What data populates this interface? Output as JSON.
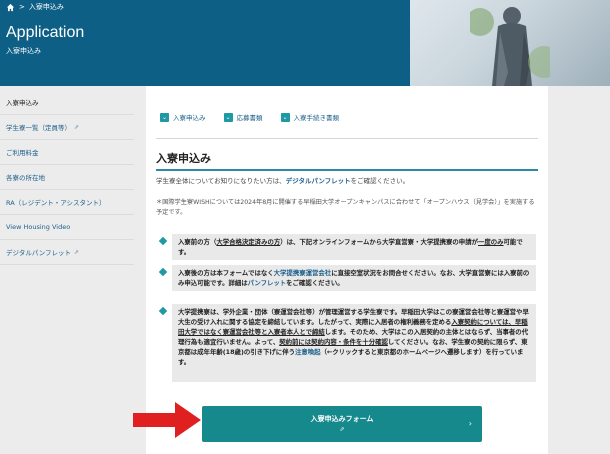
{
  "header": {
    "breadcrumb": {
      "home_icon": "home-icon",
      "separator": ">",
      "current": "入寮申込み"
    },
    "title": "Application",
    "subtitle": "入寮申込み",
    "colors": {
      "header_bg": "#0e5f86"
    }
  },
  "sidebar": {
    "items": [
      {
        "label": "入寮申込み",
        "external": false
      },
      {
        "label": "学生寮一覧（定員等）",
        "external": true
      },
      {
        "label": "ご利用料金",
        "external": false
      },
      {
        "label": "各寮の所在地",
        "external": false
      },
      {
        "label": "RA（レジデント・アシスタント）",
        "external": false
      },
      {
        "label": "View Housing Video",
        "external": false
      },
      {
        "label": "デジタルパンフレット",
        "external": true
      }
    ],
    "external_icon": "⇗"
  },
  "main": {
    "tabs": [
      {
        "label": "入寮申込み"
      },
      {
        "label": "応募書類"
      },
      {
        "label": "入寮手続き書類"
      }
    ],
    "section_title": "入寮申込み",
    "para1": {
      "before": "学生寮全体についてお知りになりたい方は、",
      "link": "デジタルパンフレット",
      "after": "をご確認ください。"
    },
    "para2": "＊国際学生寮WISHについては2024年8月に開催する早稲田大学オープンキャンパスに合わせて「オープンハウス（見学会）」を実施する予定です。",
    "note1": {
      "a": "入寮前の方（",
      "b": "大学合格決定済みの方",
      "c": "）は、下記オンラインフォームから大学直営寮・大学提携寮の申請が",
      "d": "一度のみ",
      "e": "可能です。"
    },
    "note2": {
      "a": "入寮後の方は本フォームではなく",
      "b": "大学提携寮運営会社",
      "c": "に直接空室状況をお問合せください。なお、大学直営寮には入寮前のみ申込可能です。詳細は",
      "d": "パンフレット",
      "e": "をご確認ください。"
    },
    "note3": {
      "a": "大学提携寮は、学外企業・団体（寮運営会社等）が管理運営する学生寮です。早稲田大学はこの寮運営会社等と寮運営や早大生の受け入れに関する協定を締結しています。したがって、実際に入居者の権利義務を定める",
      "b": "入寮契約については、早稲田大学ではなく寮運営会社等と入寮者本人とで締結",
      "c": "します。そのため、大学はこの入居契約の主体とはならず、当事者の代理行為も適宜行いません。よって、",
      "d": "契約前には契約内容・条件を十分確認",
      "e": "してください。なお、学生寮の契約に限らず、東京都は成年年齢(18歳)の引き下げに伴う",
      "f": "注意喚起",
      "g": "（←クリックすると東京都のホームページへ遷移します）を行っています。"
    },
    "cta": {
      "label": "入寮申込みフォーム",
      "external_icon": "⇗",
      "chevron": "›"
    },
    "colors": {
      "accent": "#15898c",
      "link": "#1c5f8a",
      "arrow": "#e02020"
    }
  }
}
